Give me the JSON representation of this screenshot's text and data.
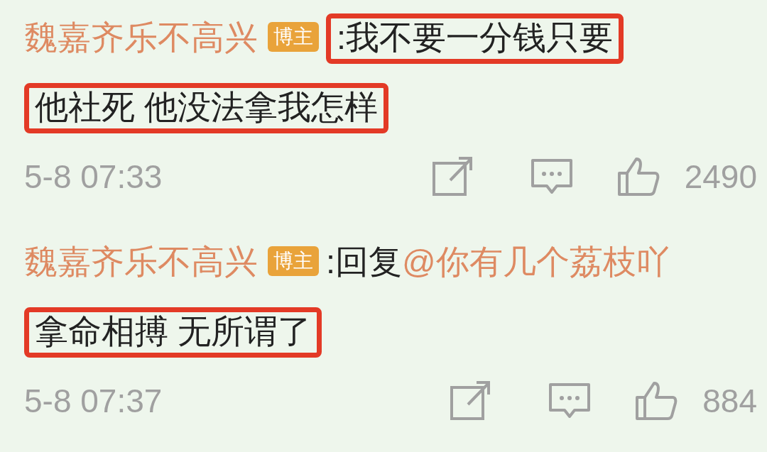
{
  "comments": [
    {
      "author": "魏嘉齐乐不高兴",
      "badge": "博主",
      "segments": [
        {
          "kind": "text",
          "text": ":我不要一分钱只要",
          "highlighted": true
        },
        {
          "kind": "text",
          "text": "他社死 他没法拿我怎样",
          "highlighted": true
        }
      ],
      "time": "5-8 07:33",
      "likes": "2490"
    },
    {
      "author": "魏嘉齐乐不高兴",
      "badge": "博主",
      "segments": [
        {
          "kind": "text",
          "text": ":回复",
          "highlighted": false
        },
        {
          "kind": "mention",
          "text": "@你有几个荔枝吖",
          "highlighted": false
        },
        {
          "kind": "text",
          "text": "拿命相搏 无所谓了",
          "highlighted": true
        }
      ],
      "time": "5-8 07:37",
      "likes": "884"
    }
  ]
}
